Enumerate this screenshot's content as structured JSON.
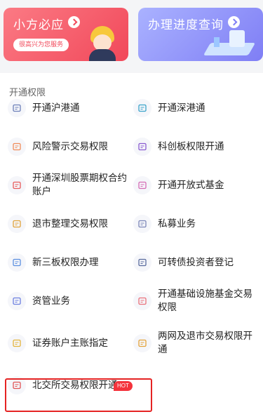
{
  "banners": {
    "left": {
      "title": "小方必应",
      "subtitle": "很高兴为您服务",
      "color": "#f1485a",
      "icon": "mascot-icon"
    },
    "right": {
      "title": "办理进度查询",
      "color": "#7f7ef5",
      "icon": "progress-illustration-icon"
    }
  },
  "section": {
    "title": "开通权限"
  },
  "items": [
    {
      "label": "开通沪港通",
      "icon": "sh-hk-icon",
      "color": "#6b7fb8"
    },
    {
      "label": "开通深港通",
      "icon": "sz-hk-icon",
      "color": "#3aa3c9"
    },
    {
      "label": "风险警示交易权限",
      "icon": "warning-card-icon",
      "color": "#f08c5a"
    },
    {
      "label": "科创板权限开通",
      "icon": "robot-icon",
      "color": "#8a5cd1"
    },
    {
      "label": "开通深圳股票期权合约账户",
      "icon": "option-account-icon",
      "color": "#e85b5b"
    },
    {
      "label": "开通开放式基金",
      "icon": "chart-up-icon",
      "color": "#d56bb5"
    },
    {
      "label": "退市整理交易权限",
      "icon": "compass-icon",
      "color": "#e0a23a"
    },
    {
      "label": "私募业务",
      "icon": "trend-line-icon",
      "color": "#7b86b8"
    },
    {
      "label": "新三板权限办理",
      "icon": "edit-doc-icon",
      "color": "#5b8fe0"
    },
    {
      "label": "可转债投资者登记",
      "icon": "bond-chart-icon",
      "color": "#5a6c9e"
    },
    {
      "label": "资管业务",
      "icon": "wave-chart-icon",
      "color": "#6b7fe0"
    },
    {
      "label": "开通基础设施基金交易权限",
      "icon": "infrastructure-icon",
      "color": "#e9707a"
    },
    {
      "label": "证券账户主账指定",
      "icon": "account-card-icon",
      "color": "#e3b33a"
    },
    {
      "label": "两网及退市交易权限开通",
      "icon": "folder-icon",
      "color": "#e3a23a"
    },
    {
      "label": "北交所交易权限开通",
      "icon": "bse-key-icon",
      "color": "#e05454"
    }
  ],
  "hot_badge": "HOT"
}
